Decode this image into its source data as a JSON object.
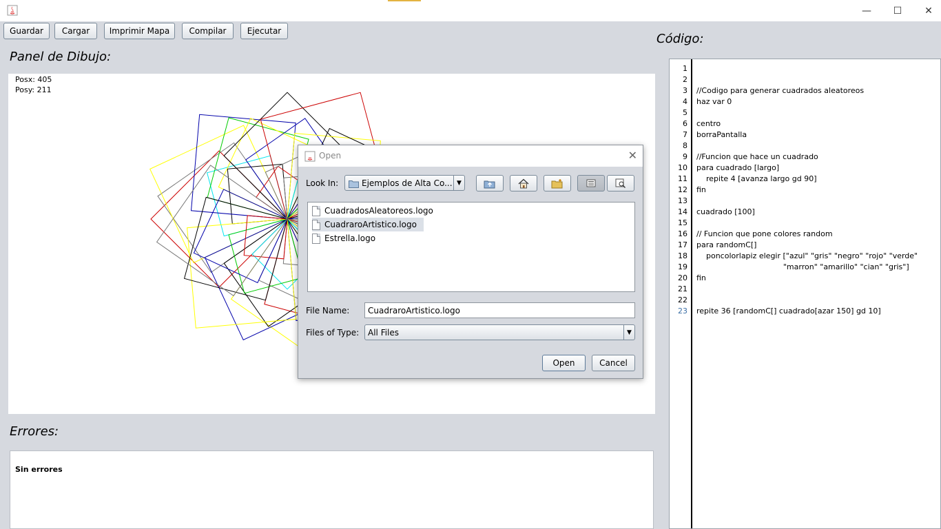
{
  "window": {
    "controls": {
      "minimize": "—",
      "maximize": "☐",
      "close": "✕"
    }
  },
  "toolbar": {
    "save_label": "Guardar",
    "load_label": "Cargar",
    "print_label": "Imprimir Mapa",
    "compile_label": "Compilar",
    "run_label": "Ejecutar"
  },
  "drawing_panel": {
    "title": "Panel de Dibujo:",
    "posx": "Posx: 405",
    "posy": "Posy: 211"
  },
  "errors_panel": {
    "title": "Errores:",
    "message": "Sin errores"
  },
  "code_panel": {
    "title": "Código:",
    "line_numbers": [
      "1",
      "2",
      "3",
      "4",
      "5",
      "6",
      "7",
      "8",
      "9",
      "10",
      "11",
      "12",
      "13",
      "14",
      "15",
      "16",
      "17",
      "18",
      "19",
      "20",
      "21",
      "22",
      "23"
    ],
    "current_line": "23",
    "lines": [
      "",
      "",
      "//Codigo para generar cuadrados aleatoreos",
      "haz var 0",
      "",
      "centro",
      "borraPantalla",
      "",
      "//Funcion que hace un cuadrado",
      "para cuadrado [largo]",
      "    repite 4 [avanza largo gd 90]",
      "fin",
      "",
      "cuadrado [100]",
      "",
      "// Funcion que pone colores random",
      "para randomC[]",
      "    poncolorlapiz elegir [\"azul\" \"gris\" \"negro\" \"rojo\" \"verde\"",
      "                                    \"marron\" \"amarillo\" \"cian\" \"gris\"]",
      "fin",
      "",
      "",
      "repite 36 [randomC[] cuadrado[azar 150] gd 10]"
    ]
  },
  "dialog": {
    "title": "Open",
    "close": "✕",
    "look_in_label": "Look In:",
    "look_in_value": "Ejemplos de Alta Co...",
    "files": [
      "CuadradosAleatoreos.logo",
      "CuadraroArtistico.logo",
      "Estrella.logo"
    ],
    "selected_file": "CuadraroArtistico.logo",
    "file_name_label": "File Name:",
    "file_name_value": "CuadraroArtistico.logo",
    "file_type_label": "Files of Type:",
    "file_type_value": "All Files",
    "open_label": "Open",
    "cancel_label": "Cancel"
  },
  "colors": {
    "background": "#d6d9df",
    "red": "#cc0000",
    "yellow": "#ffff00",
    "cyan": "#00e5ee",
    "green": "#00cc00",
    "blue": "#0000aa",
    "black": "#000000",
    "gray": "#777777"
  }
}
